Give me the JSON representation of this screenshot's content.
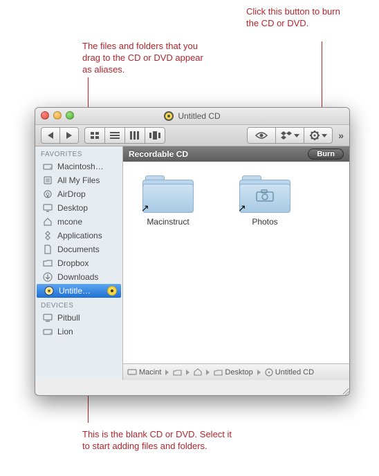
{
  "callouts": {
    "aliases": "The files and folders that you drag to the CD or DVD appear as aliases.",
    "burn": "Click this button to burn the CD or DVD.",
    "blank": "This is the blank CD or DVD. Select it to start adding files and folders."
  },
  "window": {
    "title": "Untitled CD"
  },
  "sidebar": {
    "headings": [
      "FAVORITES",
      "DEVICES"
    ],
    "favorites": [
      "Macintosh…",
      "All My Files",
      "AirDrop",
      "Desktop",
      "mcone",
      "Applications",
      "Documents",
      "Dropbox",
      "Downloads",
      "Untitle…"
    ],
    "devices": [
      "Pitbull",
      "Lion"
    ]
  },
  "main": {
    "infobar": "Recordable CD",
    "burn_label": "Burn",
    "items": [
      {
        "name": "Macinstruct"
      },
      {
        "name": "Photos"
      }
    ]
  },
  "path": [
    "Macint",
    "",
    "",
    "Desktop",
    "Untitled CD"
  ]
}
